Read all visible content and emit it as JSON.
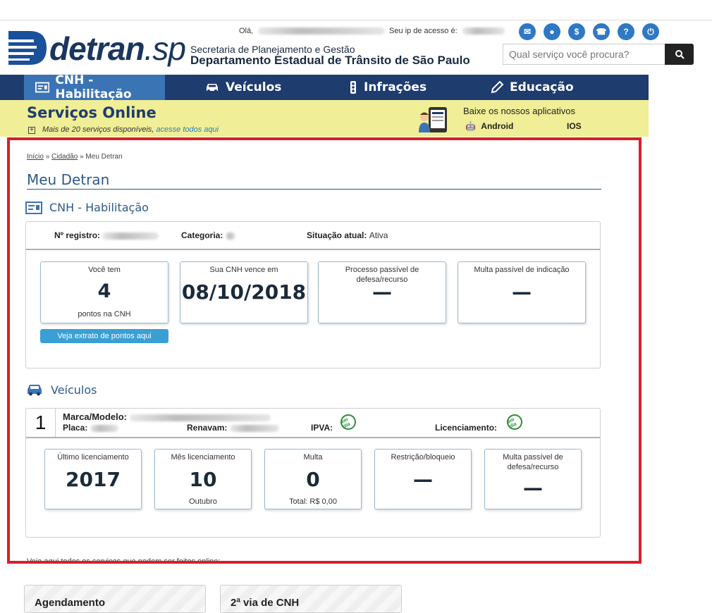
{
  "header": {
    "logo_main": "detran",
    "logo_suffix": ".sp",
    "secretaria": "Secretaria de Planejamento e Gestão",
    "departamento": "Departamento Estadual de Trânsito de São Paulo",
    "greeting": "Olá,",
    "ip_label": "Seu ip de acesso é:",
    "icons": [
      "envelope-icon",
      "user-icon",
      "coin-icon",
      "phone-icon",
      "help-icon",
      "power-icon"
    ],
    "icon_glyphs": [
      "✉",
      "●",
      "$",
      "☎",
      "?",
      "⏻"
    ],
    "search_placeholder": "Qual serviço você procura?",
    "accent_color": "#2f78c4"
  },
  "nav": {
    "items": [
      {
        "label": "CNH - Habilitação",
        "icon": "id-card-icon",
        "active": true
      },
      {
        "label": "Veículos",
        "icon": "car-icon",
        "active": false
      },
      {
        "label": "Infrações",
        "icon": "traffic-light-icon",
        "active": false
      },
      {
        "label": "Educação",
        "icon": "pencil-icon",
        "active": false
      }
    ],
    "bg_color": "#1e3c6e",
    "active_color": "#3b74b4"
  },
  "services": {
    "title": "Serviços Online",
    "subtitle": "Mais de 20 serviços disponíveis,",
    "link": "acesse todos aqui",
    "apps_title": "Baixe os nossos aplicativos",
    "android": "Android",
    "ios": "IOS"
  },
  "breadcrumb": {
    "items": [
      "Início",
      "Cidadão",
      "Meu Detran"
    ],
    "sep": "»"
  },
  "page_title": "Meu Detran",
  "cnh": {
    "title": "CNH - Habilitação",
    "registro_label": "Nº registro:",
    "categoria_label": "Categoria:",
    "situacao_label": "Situação atual:",
    "situacao_value": "Ativa",
    "cards": [
      {
        "caption": "Você tem",
        "value": "4",
        "footer": "pontos na CNH"
      },
      {
        "caption": "Sua CNH vence em",
        "value": "08/10/2018"
      },
      {
        "caption": "Processo passível de defesa/recurso",
        "value": "—"
      },
      {
        "caption": "Multa passível de indicação",
        "value": "—"
      }
    ],
    "extrato_button": "Veja extrato de pontos aqui"
  },
  "veiculos": {
    "title": "Veículos",
    "index": "1",
    "marca_label": "Marca/Modelo:",
    "placa_label": "Placa:",
    "renavam_label": "Renavam:",
    "ipva_label": "IPVA:",
    "licenciamento_label": "Licenciamento:",
    "status_badge": "em dia",
    "cards": [
      {
        "caption": "Último licenciamento",
        "value": "2017"
      },
      {
        "caption": "Mês licenciamento",
        "value": "10",
        "footer": "Outubro"
      },
      {
        "caption": "Multa",
        "value": "0",
        "footer": "Total: R$ 0,00"
      },
      {
        "caption": "Restrição/bloqueio",
        "value": "—"
      },
      {
        "caption": "Multa passível de defesa/recurso",
        "value": "—"
      }
    ]
  },
  "footnote": "Veja aqui todos os serviços que podem ser feitos online:",
  "below_cards": [
    "Agendamento",
    "2ª via de CNH"
  ]
}
